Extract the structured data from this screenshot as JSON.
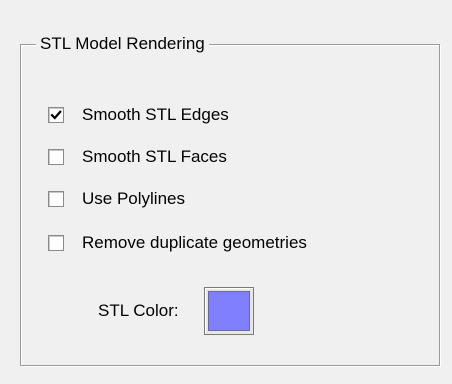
{
  "group": {
    "title": "STL Model Rendering"
  },
  "options": [
    {
      "label": "Smooth STL Edges",
      "checked": true
    },
    {
      "label": "Smooth STL Faces",
      "checked": false
    },
    {
      "label": "Use Polylines",
      "checked": false
    },
    {
      "label": "Remove duplicate geometries",
      "checked": false
    }
  ],
  "stl_color": {
    "label": "STL Color:",
    "value": "#8080ff"
  },
  "colors": {
    "background": "#f0f0f0",
    "border": "#9a9a9a",
    "text": "#000000"
  },
  "icons": {
    "checkmark": "checkmark-icon"
  }
}
